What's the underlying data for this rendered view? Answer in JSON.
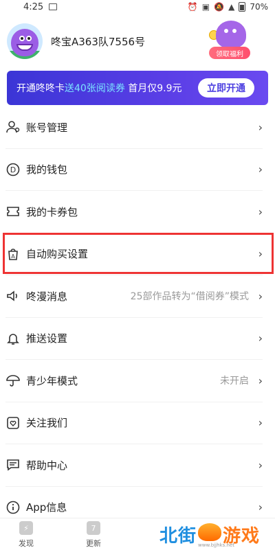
{
  "status_bar": {
    "time": "4:25",
    "battery": "70%"
  },
  "profile": {
    "username": "咚宝A363队7556号",
    "reward_label": "领取福利"
  },
  "banner": {
    "text_prefix": "开通咚咚卡",
    "text_highlight": "送40张阅读券",
    "text_suffix": " 首月仅9.9元",
    "button_label": "立即开通"
  },
  "menu": {
    "items": [
      {
        "label": "账号管理",
        "value": "",
        "icon": "user-manage-icon"
      },
      {
        "label": "我的钱包",
        "value": "",
        "icon": "wallet-icon"
      },
      {
        "label": "我的卡券包",
        "value": "",
        "icon": "ticket-icon"
      },
      {
        "label": "自动购买设置",
        "value": "",
        "icon": "auto-buy-icon"
      },
      {
        "label": "咚漫消息",
        "value": "25部作品转为“借阅券”模式",
        "icon": "speaker-icon"
      },
      {
        "label": "推送设置",
        "value": "",
        "icon": "bell-icon"
      },
      {
        "label": "青少年模式",
        "value": "未开启",
        "icon": "umbrella-icon"
      },
      {
        "label": "关注我们",
        "value": "",
        "icon": "heart-icon"
      },
      {
        "label": "帮助中心",
        "value": "",
        "icon": "chat-icon"
      },
      {
        "label": "App信息",
        "value": "",
        "icon": "info-icon"
      }
    ]
  },
  "bottom_nav": {
    "tabs": [
      {
        "label": "发现",
        "icon": "discover-icon"
      },
      {
        "label": "更新",
        "icon": "update-icon",
        "icon_text": "7"
      }
    ]
  },
  "watermark": {
    "left": "北街",
    "right": "游戏",
    "url": "www.bjjhks.net"
  },
  "colors": {
    "highlight_box": "#ee3333",
    "banner_accent": "#7be3ff",
    "banner_bg": "#4b3ee0"
  }
}
